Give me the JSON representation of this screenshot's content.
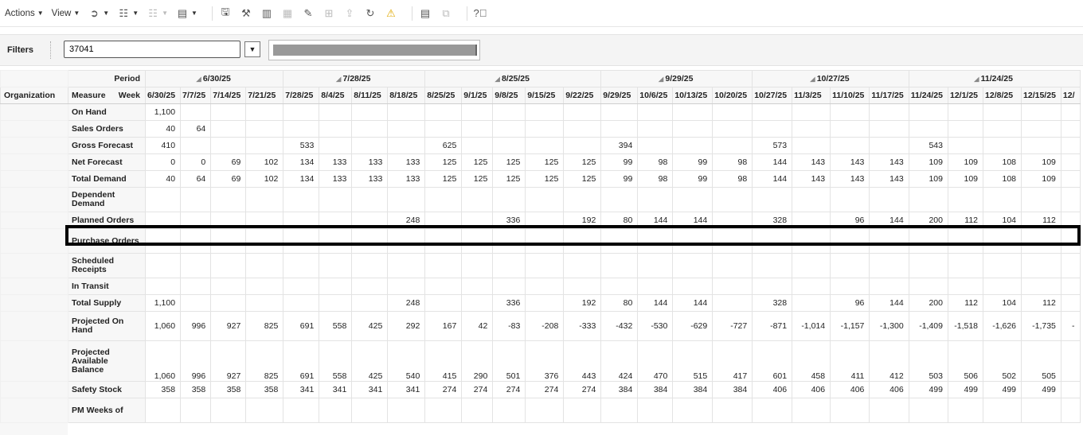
{
  "toolbar": {
    "actions_label": "Actions",
    "view_label": "View",
    "icons": [
      "circle-arrow-icon",
      "grid-menu-icon",
      "grid-dim-icon",
      "calculator-icon",
      "save-icon",
      "tools-icon",
      "bar-chart-icon",
      "chart-dim-icon",
      "pencil-icon",
      "table-edit-icon",
      "upload-icon",
      "refresh-icon",
      "warning-icon",
      "report-icon",
      "copy-icon",
      "help-icon"
    ]
  },
  "filters": {
    "label": "Filters",
    "item_value": "37041"
  },
  "grid": {
    "org_header": "Organization",
    "period_label": "Period",
    "measure_label": "Measure",
    "week_label": "Week",
    "periods": [
      {
        "label": "6/30/25",
        "span": 4
      },
      {
        "label": "7/28/25",
        "span": 4
      },
      {
        "label": "8/25/25",
        "span": 5
      },
      {
        "label": "9/29/25",
        "span": 4
      },
      {
        "label": "10/27/25",
        "span": 4
      },
      {
        "label": "11/24/25",
        "span": 5
      }
    ],
    "weeks": [
      "6/30/25",
      "7/7/25",
      "7/14/25",
      "7/21/25",
      "7/28/25",
      "8/4/25",
      "8/11/25",
      "8/18/25",
      "8/25/25",
      "9/1/25",
      "9/8/25",
      "9/15/25",
      "9/22/25",
      "9/29/25",
      "10/6/25",
      "10/13/25",
      "10/20/25",
      "10/27/25",
      "11/3/25",
      "11/10/25",
      "11/17/25",
      "11/24/25",
      "12/1/25",
      "12/8/25",
      "12/15/25",
      "12/"
    ],
    "rows": [
      {
        "measure": "On Hand",
        "values": [
          "1,100",
          "",
          "",
          "",
          "",
          "",
          "",
          "",
          "",
          "",
          "",
          "",
          "",
          "",
          "",
          "",
          "",
          "",
          "",
          "",
          "",
          "",
          "",
          "",
          "",
          ""
        ]
      },
      {
        "measure": "Sales Orders",
        "values": [
          "40",
          "64",
          "",
          "",
          "",
          "",
          "",
          "",
          "",
          "",
          "",
          "",
          "",
          "",
          "",
          "",
          "",
          "",
          "",
          "",
          "",
          "",
          "",
          "",
          "",
          ""
        ]
      },
      {
        "measure": "Gross Forecast",
        "values": [
          "410",
          "",
          "",
          "",
          "533",
          "",
          "",
          "",
          "625",
          "",
          "",
          "",
          "",
          "394",
          "",
          "",
          "",
          "573",
          "",
          "",
          "",
          "543",
          "",
          "",
          "",
          ""
        ]
      },
      {
        "measure": "Net Forecast",
        "values": [
          "0",
          "0",
          "69",
          "102",
          "134",
          "133",
          "133",
          "133",
          "125",
          "125",
          "125",
          "125",
          "125",
          "99",
          "98",
          "99",
          "98",
          "144",
          "143",
          "143",
          "143",
          "109",
          "109",
          "108",
          "109",
          ""
        ]
      },
      {
        "measure": "Total Demand",
        "values": [
          "40",
          "64",
          "69",
          "102",
          "134",
          "133",
          "133",
          "133",
          "125",
          "125",
          "125",
          "125",
          "125",
          "99",
          "98",
          "99",
          "98",
          "144",
          "143",
          "143",
          "143",
          "109",
          "109",
          "108",
          "109",
          ""
        ]
      },
      {
        "measure": "Dependent Demand",
        "values": [
          "",
          "",
          "",
          "",
          "",
          "",
          "",
          "",
          "",
          "",
          "",
          "",
          "",
          "",
          "",
          "",
          "",
          "",
          "",
          "",
          "",
          "",
          "",
          "",
          "",
          ""
        ]
      },
      {
        "measure": "Planned Orders",
        "values": [
          "",
          "",
          "",
          "",
          "",
          "",
          "",
          "248",
          "",
          "",
          "336",
          "",
          "192",
          "80",
          "144",
          "144",
          "",
          "328",
          "",
          "96",
          "144",
          "200",
          "112",
          "104",
          "112",
          ""
        ]
      },
      {
        "measure": "Purchase Orders",
        "values": [
          "",
          "",
          "",
          "",
          "",
          "",
          "",
          "",
          "",
          "",
          "",
          "",
          "",
          "",
          "",
          "",
          "",
          "",
          "",
          "",
          "",
          "",
          "",
          "",
          "",
          ""
        ]
      },
      {
        "measure": "Scheduled Receipts",
        "values": [
          "",
          "",
          "",
          "",
          "",
          "",
          "",
          "",
          "",
          "",
          "",
          "",
          "",
          "",
          "",
          "",
          "",
          "",
          "",
          "",
          "",
          "",
          "",
          "",
          "",
          ""
        ]
      },
      {
        "measure": "In Transit",
        "values": [
          "",
          "",
          "",
          "",
          "",
          "",
          "",
          "",
          "",
          "",
          "",
          "",
          "",
          "",
          "",
          "",
          "",
          "",
          "",
          "",
          "",
          "",
          "",
          "",
          "",
          ""
        ]
      },
      {
        "measure": "Total Supply",
        "values": [
          "1,100",
          "",
          "",
          "",
          "",
          "",
          "",
          "248",
          "",
          "",
          "336",
          "",
          "192",
          "80",
          "144",
          "144",
          "",
          "328",
          "",
          "96",
          "144",
          "200",
          "112",
          "104",
          "112",
          ""
        ]
      },
      {
        "measure": "Projected On Hand",
        "values": [
          "1,060",
          "996",
          "927",
          "825",
          "691",
          "558",
          "425",
          "292",
          "167",
          "42",
          "-83",
          "-208",
          "-333",
          "-432",
          "-530",
          "-629",
          "-727",
          "-871",
          "-1,014",
          "-1,157",
          "-1,300",
          "-1,409",
          "-1,518",
          "-1,626",
          "-1,735",
          "-"
        ]
      },
      {
        "measure": "Projected Available Balance",
        "values": [
          "1,060",
          "996",
          "927",
          "825",
          "691",
          "558",
          "425",
          "540",
          "415",
          "290",
          "501",
          "376",
          "443",
          "424",
          "470",
          "515",
          "417",
          "601",
          "458",
          "411",
          "412",
          "503",
          "506",
          "502",
          "505",
          ""
        ]
      },
      {
        "measure": "Safety Stock",
        "values": [
          "358",
          "358",
          "358",
          "358",
          "341",
          "341",
          "341",
          "341",
          "274",
          "274",
          "274",
          "274",
          "274",
          "384",
          "384",
          "384",
          "384",
          "406",
          "406",
          "406",
          "406",
          "499",
          "499",
          "499",
          "499",
          ""
        ]
      },
      {
        "measure": "PM Weeks of",
        "values": [
          "",
          "",
          "",
          "",
          "",
          "",
          "",
          "",
          "",
          "",
          "",
          "",
          "",
          "",
          "",
          "",
          "",
          "",
          "",
          "",
          "",
          "",
          "",
          "",
          "",
          ""
        ]
      }
    ]
  }
}
